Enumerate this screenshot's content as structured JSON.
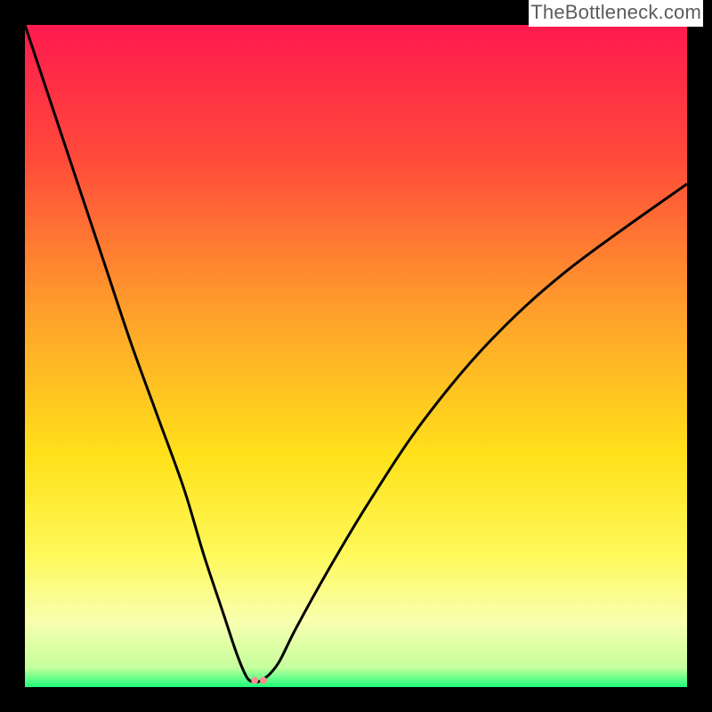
{
  "watermark": "TheBottleneck.com",
  "chart_data": {
    "type": "line",
    "title": "",
    "xlabel": "",
    "ylabel": "",
    "xlim": [
      0,
      100
    ],
    "ylim": [
      0,
      100
    ],
    "grid": false,
    "legend": false,
    "background_gradient": {
      "stops": [
        {
          "offset": 0,
          "color": "#ff1a4f"
        },
        {
          "offset": 20,
          "color": "#ff4a3a"
        },
        {
          "offset": 45,
          "color": "#ffa52a"
        },
        {
          "offset": 65,
          "color": "#ffe11a"
        },
        {
          "offset": 80,
          "color": "#fff95a"
        },
        {
          "offset": 90,
          "color": "#f8ffae"
        },
        {
          "offset": 97,
          "color": "#c7ff9d"
        },
        {
          "offset": 100,
          "color": "#1cff7a"
        }
      ]
    },
    "series": [
      {
        "name": "bottleneck-curve",
        "color": "#000000",
        "x": [
          0,
          4,
          8,
          12,
          16,
          20,
          24,
          27,
          30,
          32,
          33.5,
          34.5,
          35.2,
          36,
          37,
          38.5,
          41,
          46,
          52,
          60,
          70,
          82,
          100
        ],
        "y": [
          100,
          88,
          76,
          64,
          52,
          41,
          30,
          20,
          11,
          5,
          1.5,
          0.8,
          0.8,
          1.2,
          2,
          4,
          9,
          18,
          28,
          40,
          52,
          63,
          76
        ]
      }
    ],
    "markers": [
      {
        "name": "dot-left",
        "x": 34.7,
        "y": 1.0,
        "color": "#ff8e8e",
        "r": 4
      },
      {
        "name": "dot-right",
        "x": 36.0,
        "y": 1.0,
        "color": "#ff8e8e",
        "r": 4
      }
    ]
  }
}
